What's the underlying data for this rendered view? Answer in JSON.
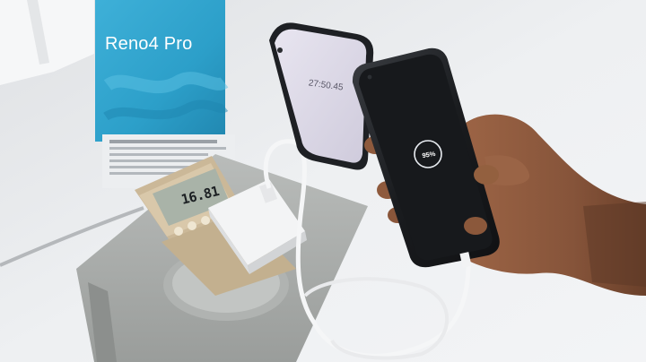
{
  "product_box": {
    "brand_text": "Reno4 Pro"
  },
  "power_meter": {
    "reading": "16.81"
  },
  "back_phone": {
    "timer": "27:50.45"
  },
  "front_phone": {
    "charge_percent": "95%"
  },
  "colors": {
    "box_blue": "#2c9fc9",
    "table_white": "#ecedef",
    "phone_screen": "#17191c",
    "timer_screen": "#dcd9e8",
    "meter_body": "#cdbb9e",
    "socket_grey": "#a8aba9",
    "skin": "#8d5a3c"
  }
}
